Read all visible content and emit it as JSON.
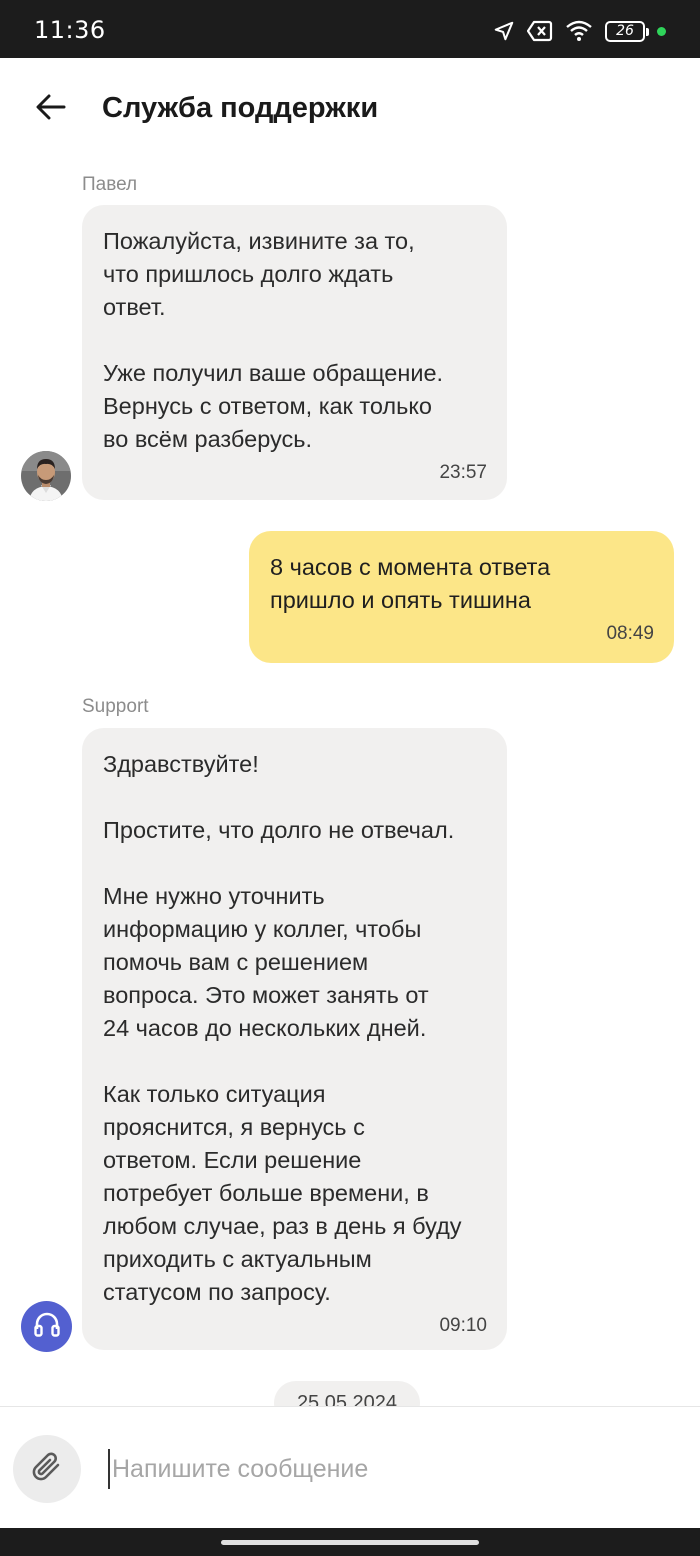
{
  "status_bar": {
    "time": "11:36",
    "battery": "26",
    "icons": [
      "location-icon",
      "no-sim-icon",
      "wifi-icon",
      "battery-icon",
      "indicator-dot"
    ]
  },
  "header": {
    "back_icon": "arrow-left-icon",
    "title": "Служба поддержки"
  },
  "messages": [
    {
      "direction": "incoming",
      "sender": "Павел",
      "text": "Пожалуйста, извините за то,\nчто пришлось долго ждать\nответ.\n\nУже получил ваше обращение.\nВернусь с ответом, как только\nво всём разберусь.",
      "time": "23:57",
      "avatar": "agent-photo"
    },
    {
      "direction": "outgoing",
      "text": "8 часов с момента ответа\nпришло и опять тишина",
      "time": "08:49"
    },
    {
      "direction": "incoming",
      "sender": "Support",
      "text": "Здравствуйте!\n\nПростите, что долго не отвечал.\n\nМне нужно уточнить\nинформацию у коллег, чтобы\nпомочь вам с решением\nвопроса. Это может занять от\n24 часов до нескольких дней.\n\nКак только ситуация\nпрояснится, я вернусь с\nответом. Если решение\nпотребует больше времени, в\nлюбом случае, раз в день я буду\nприходить с актуальным\nстатусом по запросу.",
      "time": "09:10",
      "avatar": "headphones-icon"
    }
  ],
  "date_separator": "25.05.2024",
  "composer": {
    "attach_icon": "paperclip-icon",
    "placeholder": "Напишите сообщение",
    "value": ""
  },
  "colors": {
    "incoming_bubble": "#f1f0ef",
    "outgoing_bubble": "#fce688",
    "support_avatar": "#5360d0"
  }
}
